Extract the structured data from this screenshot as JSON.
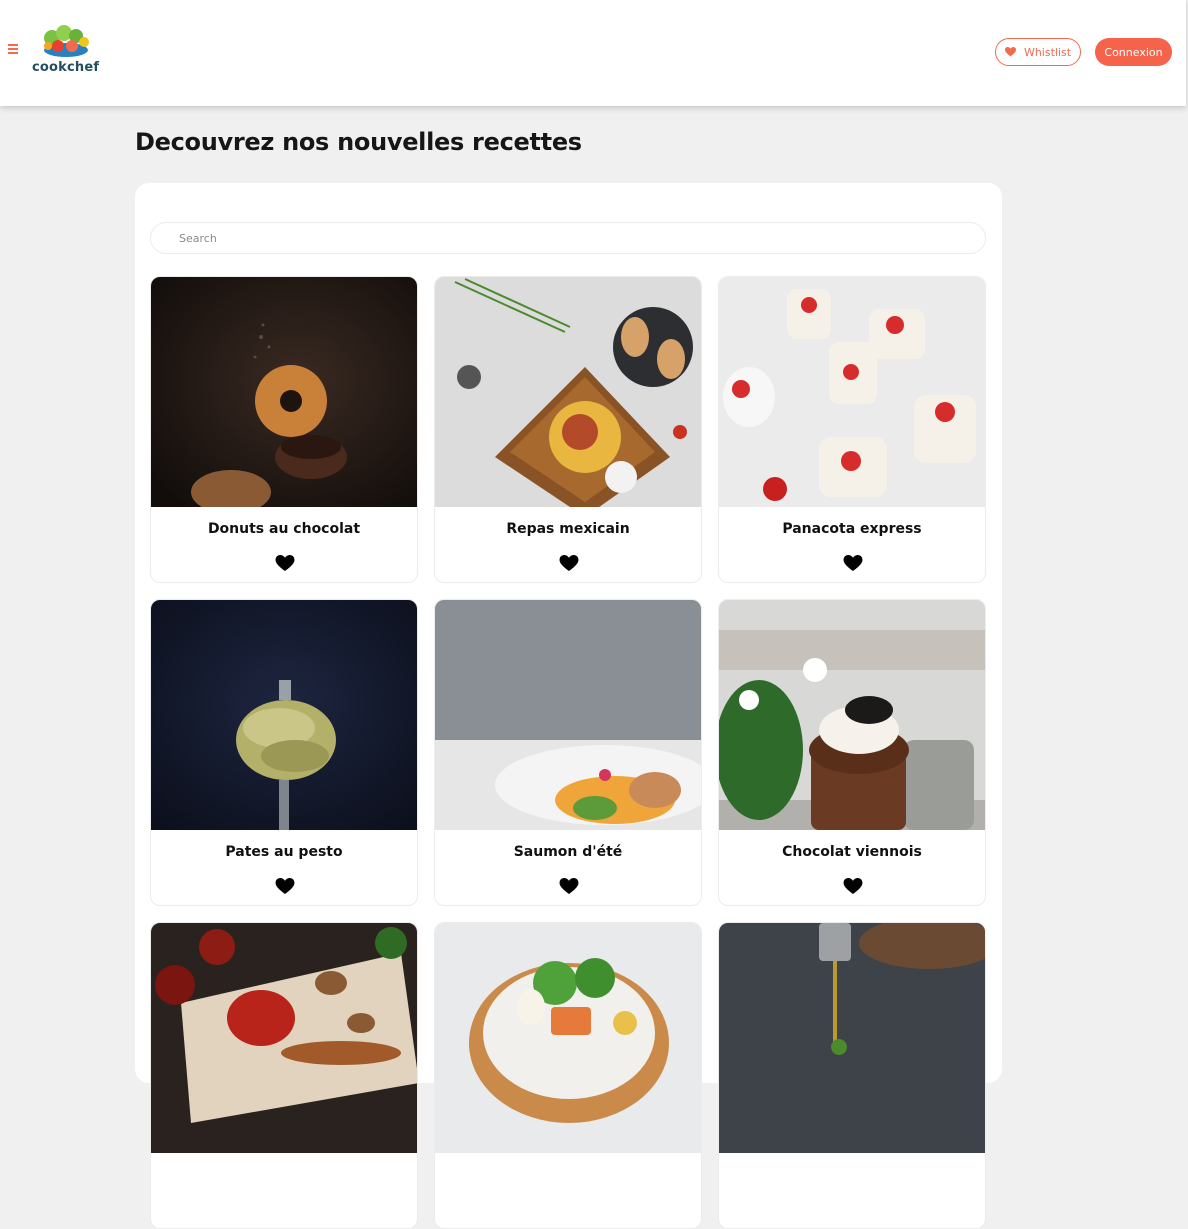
{
  "header": {
    "logo_text": "cookchef",
    "whislist_label": "Whistlist",
    "connexion_label": "Connexion"
  },
  "page": {
    "title": "Decouvrez nos nouvelles recettes"
  },
  "search": {
    "placeholder": "Search"
  },
  "recipes": [
    {
      "title": "Donuts au chocolat",
      "image": "donuts-photo"
    },
    {
      "title": "Repas mexicain",
      "image": "nachos-photo"
    },
    {
      "title": "Panacota express",
      "image": "panna-cotta-photo"
    },
    {
      "title": "Pates au pesto",
      "image": "pesto-pasta-photo"
    },
    {
      "title": "Saumon d'été",
      "image": "salmon-photo"
    },
    {
      "title": "Chocolat viennois",
      "image": "chocolate-dessert-photo"
    },
    {
      "title": "",
      "image": "grilled-meat-photo"
    },
    {
      "title": "",
      "image": "salad-bowl-photo"
    },
    {
      "title": "",
      "image": "oil-pour-photo"
    }
  ],
  "icons": {
    "menu": "hamburger-menu-icon",
    "favorite": "heart-icon"
  },
  "colors": {
    "accent": "#f5634a",
    "background": "#f0f0f0",
    "logo_text": "#234d63"
  }
}
